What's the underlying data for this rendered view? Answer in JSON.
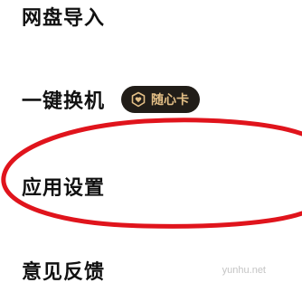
{
  "menu": {
    "items": [
      {
        "label": "网盘导入"
      },
      {
        "label": "一键换机",
        "badge": {
          "label": "随心卡",
          "icon": "heart-shield-icon"
        }
      },
      {
        "label": "应用设置"
      },
      {
        "label": "意见反馈"
      }
    ]
  },
  "watermark": {
    "text": "yunhu.net"
  },
  "colors": {
    "text": "#111111",
    "badge_background": "#211d18",
    "badge_text": "#e3bf86",
    "annotation": "#e0141c",
    "watermark": "#c4c4c4"
  }
}
